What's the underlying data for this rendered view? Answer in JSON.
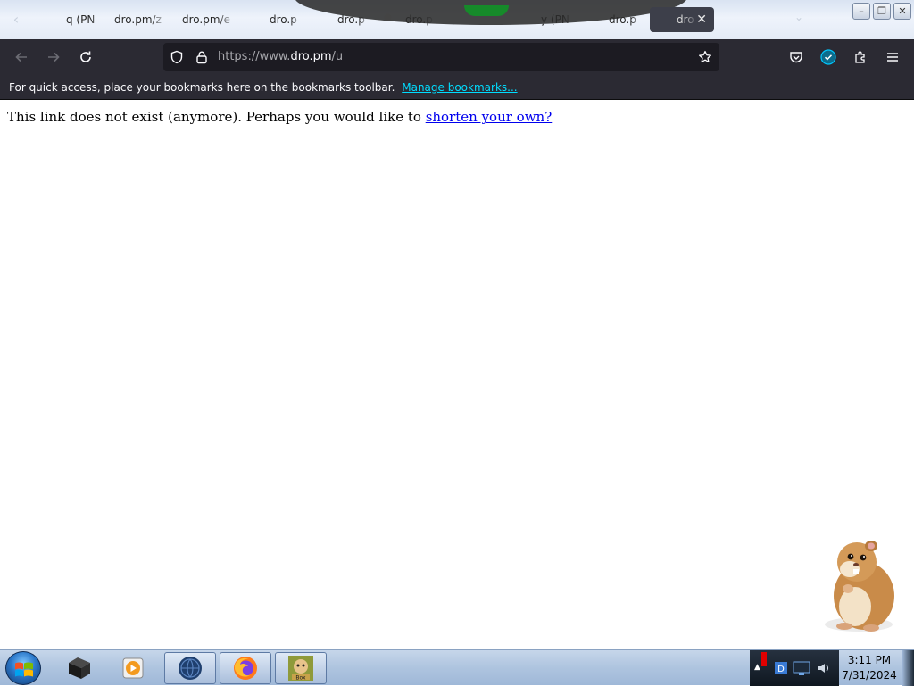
{
  "tabs": [
    {
      "label": "q (PN",
      "active": false
    },
    {
      "label": "dro.pm/z",
      "active": false
    },
    {
      "label": "dro.pm/e",
      "active": false
    },
    {
      "label": "dro.p",
      "active": false
    },
    {
      "label": "dro.p",
      "active": false
    },
    {
      "label": "dro.p",
      "active": false
    },
    {
      "label": "y (PN",
      "active": false
    },
    {
      "label": "dro.p",
      "active": false
    },
    {
      "label": "dro",
      "active": true
    }
  ],
  "tab_close_glyph": "✕",
  "window_controls": {
    "minimize": "–",
    "restore": "❐",
    "close": "✕"
  },
  "address_bar": {
    "prefix": "https://www.",
    "host": "dro.pm",
    "path": "/u"
  },
  "bookmarks_toolbar": {
    "message": "For quick access, place your bookmarks here on the bookmarks toolbar.",
    "manage_link": "Manage bookmarks..."
  },
  "page": {
    "text": "This link does not exist (anymore). Perhaps you would like to ",
    "link": "shorten your own?"
  },
  "taskbar": {
    "pinned": [
      "file-manager-icon",
      "media-player-icon",
      "browser-globe-icon",
      "firefox-icon",
      "sandboxie-icon"
    ],
    "clock_time": "3:11 PM",
    "clock_date": "7/31/2024"
  },
  "colors": {
    "toolbar_bg": "#2b2a33",
    "urlbar_bg": "#1c1b22",
    "link_blue": "#0000ee",
    "bookmark_link": "#00ddff",
    "accent_check": "#00c8ff"
  }
}
